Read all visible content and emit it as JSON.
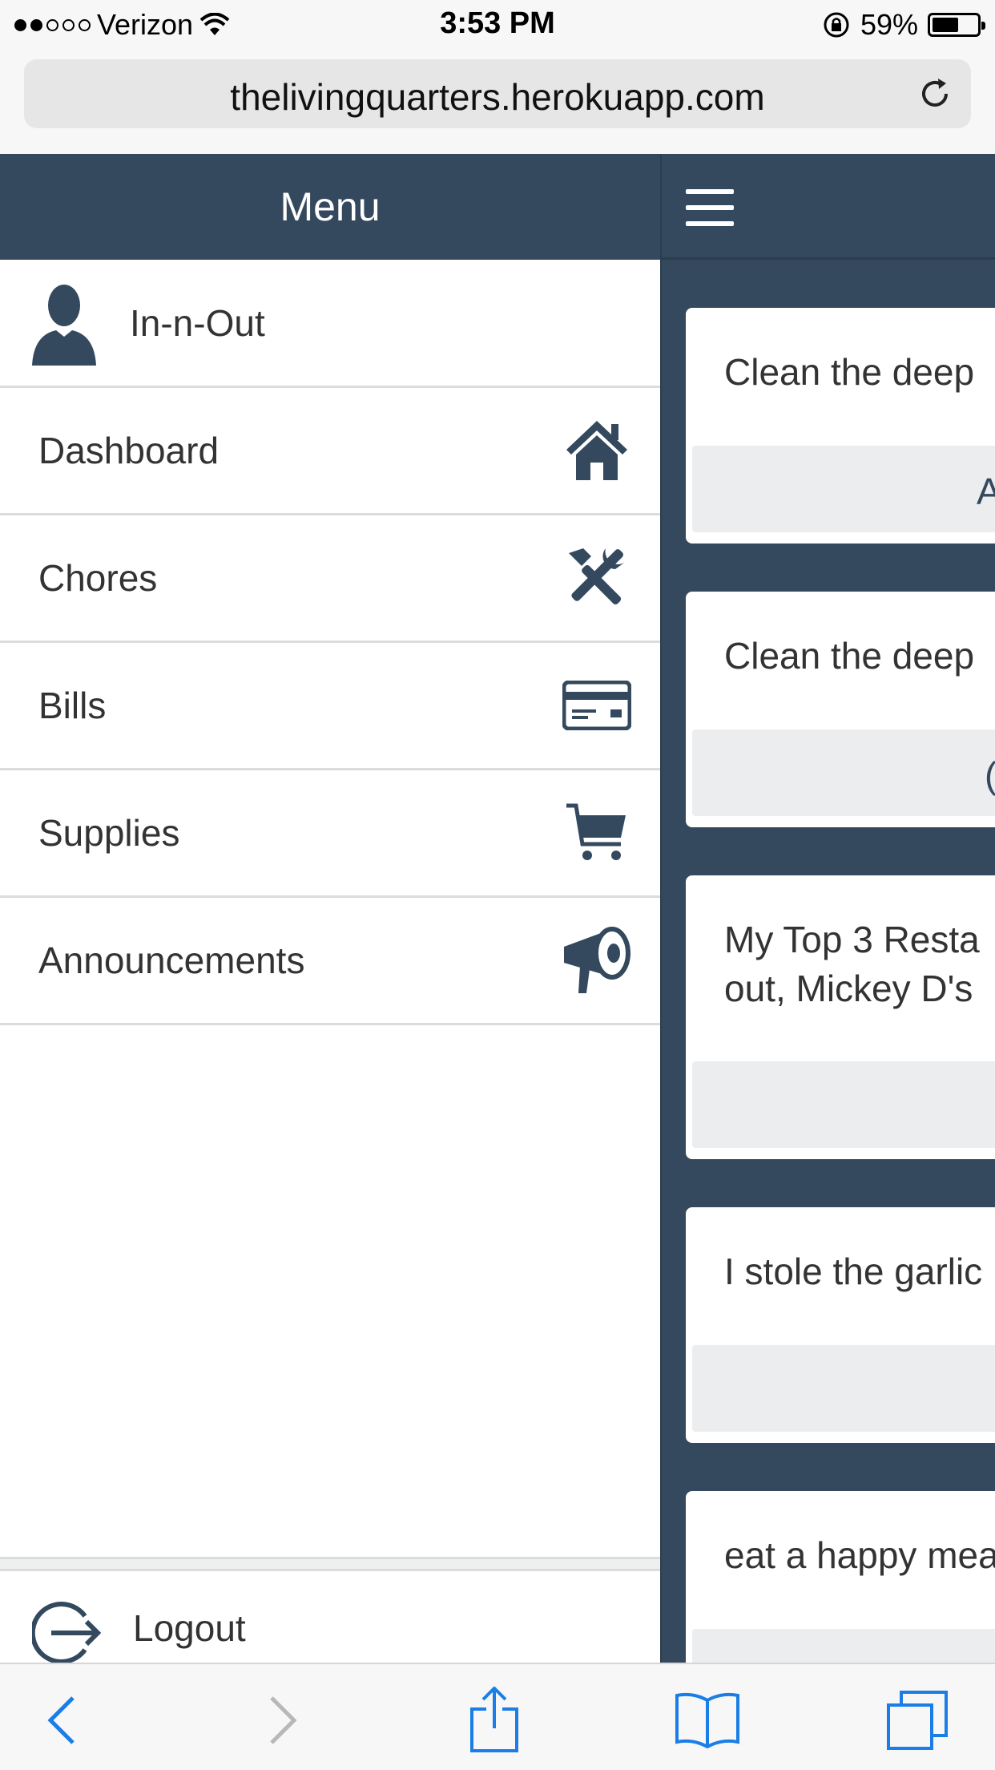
{
  "status_bar": {
    "carrier": "Verizon",
    "time": "3:53 PM",
    "battery_text": "59%",
    "battery_level": 0.59
  },
  "browser": {
    "url": "thelivingquarters.herokuapp.com"
  },
  "menu": {
    "title": "Menu",
    "user_name": "In-n-Out",
    "items": [
      {
        "label": "Dashboard",
        "icon": "home-icon"
      },
      {
        "label": "Chores",
        "icon": "tools-icon"
      },
      {
        "label": "Bills",
        "icon": "credit-card-icon"
      },
      {
        "label": "Supplies",
        "icon": "cart-icon"
      },
      {
        "label": "Announcements",
        "icon": "megaphone-icon"
      }
    ],
    "logout_label": "Logout"
  },
  "feed": {
    "cards": [
      {
        "text": "Clean the deep",
        "footer": "A"
      },
      {
        "text": "Clean the deep",
        "footer": "("
      },
      {
        "text": "My Top 3 Resta",
        "text2": "out, Mickey D's",
        "footer": ""
      },
      {
        "text": "I stole the garlic",
        "footer": ""
      },
      {
        "text": "eat a happy mea",
        "footer": ""
      }
    ]
  },
  "colors": {
    "primary": "#34495e",
    "menu_bg": "#ffffff",
    "ios_blue": "#1a7ee6"
  }
}
